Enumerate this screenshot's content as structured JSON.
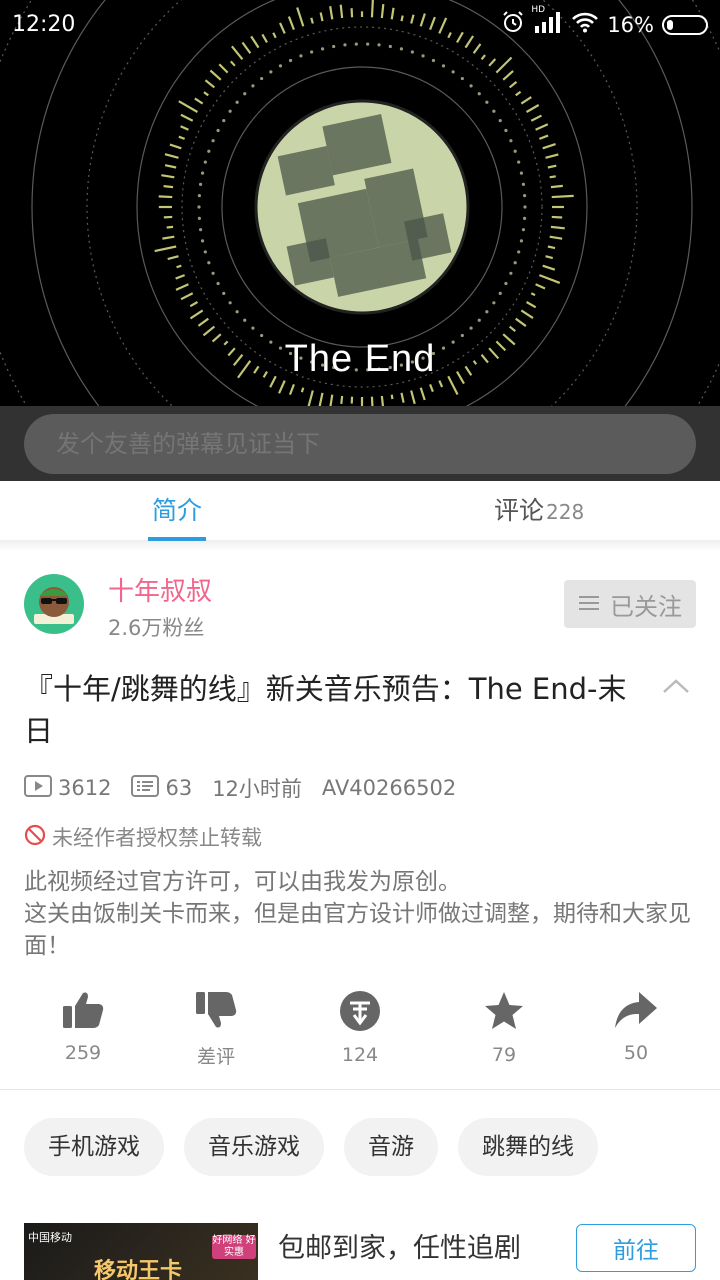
{
  "status_bar": {
    "time": "12:20",
    "signal_label": "HD",
    "battery": "16%"
  },
  "video": {
    "caption": "The End"
  },
  "danmaku": {
    "placeholder": "发个友善的弹幕见证当下"
  },
  "tabs": [
    {
      "label": "简介",
      "active": true
    },
    {
      "label": "评论",
      "count": "228",
      "active": false
    }
  ],
  "uploader": {
    "name": "十年叔叔",
    "fans": "2.6万粉丝",
    "follow_label": "已关注"
  },
  "video_info": {
    "title": "『十年/跳舞的线』新关音乐预告：The End-末日",
    "views": "3612",
    "danmaku_count": "63",
    "time_ago": "12小时前",
    "av_id": "AV40266502",
    "notice": "未经作者授权禁止转载",
    "description_lines": [
      "此视频经过官方许可，可以由我发为原创。",
      "这关由饭制关卡而来，但是由官方设计师做过调整，期待和大家见面！"
    ]
  },
  "actions": [
    {
      "icon": "thumbs-up-icon",
      "label": "259"
    },
    {
      "icon": "thumbs-down-icon",
      "label": "差评"
    },
    {
      "icon": "coin-icon",
      "label": "124"
    },
    {
      "icon": "star-icon",
      "label": "79"
    },
    {
      "icon": "share-icon",
      "label": "50"
    }
  ],
  "tags": [
    "手机游戏",
    "音乐游戏",
    "音游",
    "跳舞的线"
  ],
  "ad": {
    "text": "包邮到家，任性追剧",
    "button_label": "前往",
    "image_text": "移动王卡",
    "image_badge": "好网络 好实惠"
  },
  "colors": {
    "accent": "#2d9de0",
    "uploader_pink": "#f3658c",
    "visualizer_yellow": "#e6e88a"
  }
}
